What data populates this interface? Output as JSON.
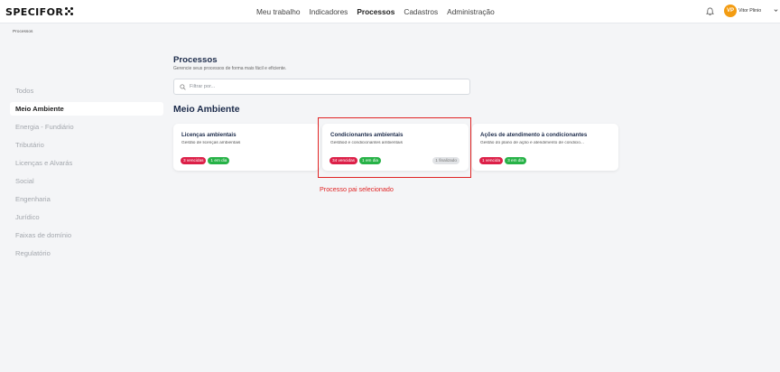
{
  "app": {
    "logo_text": "SPECIFOR"
  },
  "nav": {
    "items": [
      {
        "label": "Meu trabalho",
        "active": false
      },
      {
        "label": "Indicadores",
        "active": false
      },
      {
        "label": "Processos",
        "active": true
      },
      {
        "label": "Cadastros",
        "active": false
      },
      {
        "label": "Administração",
        "active": false
      }
    ]
  },
  "user": {
    "initials": "VP",
    "name": "Vitor Plinio"
  },
  "breadcrumb": "Processos",
  "sidebar": {
    "items": [
      {
        "label": "Todos",
        "active": false
      },
      {
        "label": "Meio Ambiente",
        "active": true
      },
      {
        "label": "Energia - Fundiário",
        "active": false
      },
      {
        "label": "Tributário",
        "active": false
      },
      {
        "label": "Licenças e Alvarás",
        "active": false
      },
      {
        "label": "Social",
        "active": false
      },
      {
        "label": "Engenharia",
        "active": false
      },
      {
        "label": "Jurídico",
        "active": false
      },
      {
        "label": "Faixas de domínio",
        "active": false
      },
      {
        "label": "Regulatório",
        "active": false
      }
    ]
  },
  "main": {
    "title": "Processos",
    "subtitle": "Gerencie seus processos de forma mais fácil e eficiente.",
    "filter_placeholder": "Filtrar por...",
    "section_title": "Meio Ambiente",
    "cards": [
      {
        "title": "Licenças ambientais",
        "description": "Gestão de licenças ambientais",
        "badge_red": "3 vencidas",
        "badge_green": "1 em dia",
        "badge_gray": ""
      },
      {
        "title": "Condicionantes ambientais",
        "description": "Gestãod e condicionantes ambientais",
        "badge_red": "34 vencidas",
        "badge_green": "1 em dia",
        "badge_gray": "1 finalizado"
      },
      {
        "title": "Ações de atendimento à condicionantes",
        "description": "Gestão do plano de ação e atendimento de condicio...",
        "badge_red": "1 vencida",
        "badge_green": "3 em dia",
        "badge_gray": ""
      }
    ]
  },
  "annotation": {
    "label": "Processo pai selecionado",
    "color": "#e02424"
  },
  "colors": {
    "accent_red": "#dc2048",
    "accent_green": "#27b247",
    "avatar": "#f39c12",
    "title_navy": "#1b2a4a"
  }
}
